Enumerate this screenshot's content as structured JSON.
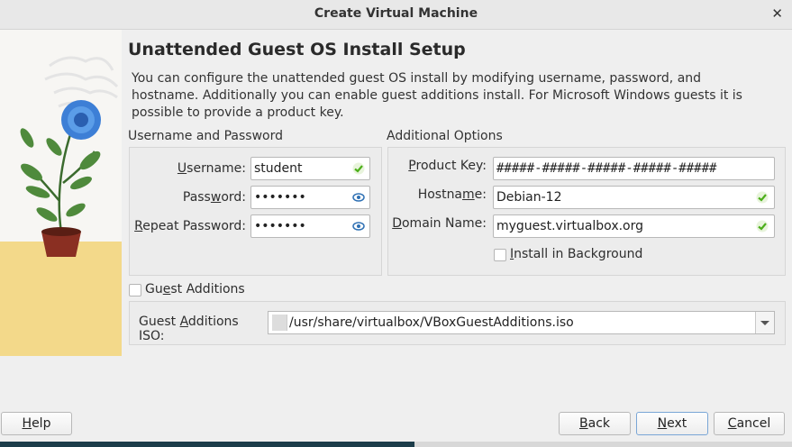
{
  "window": {
    "title": "Create Virtual Machine",
    "close_glyph": "✕"
  },
  "page": {
    "heading": "Unattended Guest OS Install Setup",
    "description": "You can configure the unattended guest OS install by modifying username, password, and hostname. Additionally you can enable guest additions install. For Microsoft Windows guests it is possible to provide a product key."
  },
  "credentials": {
    "group_title": "Username and Password",
    "username_label_pre": "",
    "username_label_u": "U",
    "username_label_post": "sername:",
    "username_value": "student",
    "password_label_pre": "Pass",
    "password_label_u": "w",
    "password_label_post": "ord:",
    "password_value": "•••••••",
    "repeat_label_pre": "",
    "repeat_label_u": "R",
    "repeat_label_post": "epeat Password:",
    "repeat_value": "•••••••"
  },
  "additional": {
    "group_title": "Additional Options",
    "product_key_label_pre": "",
    "product_key_label_u": "P",
    "product_key_label_post": "roduct Key:",
    "product_key_value": "#####-#####-#####-#####-#####",
    "hostname_label_pre": "Hostna",
    "hostname_label_u": "m",
    "hostname_label_post": "e:",
    "hostname_value": "Debian-12",
    "domain_label_pre": "",
    "domain_label_u": "D",
    "domain_label_post": "omain Name:",
    "domain_value": "myguest.virtualbox.org",
    "install_bg_pre": "",
    "install_bg_u": "I",
    "install_bg_post": "nstall in Background",
    "install_bg_checked": false
  },
  "guest_additions": {
    "checkbox_pre": "Gu",
    "checkbox_u": "e",
    "checkbox_post": "st Additions",
    "checked": false,
    "iso_label_pre": "Guest ",
    "iso_label_u": "A",
    "iso_label_post": "dditions ISO:",
    "iso_value": "/usr/share/virtualbox/VBoxGuestAdditions.iso"
  },
  "buttons": {
    "help_u": "H",
    "help_post": "elp",
    "back_u": "B",
    "back_post": "ack",
    "next_u": "N",
    "next_post": "ext",
    "cancel_u": "C",
    "cancel_post": "ancel"
  },
  "colors": {
    "ok_green": "#4caf1a",
    "eye_blue": "#2d6fb3",
    "accent": "#7aa6d6"
  },
  "icons": [
    "close-icon",
    "ok-check-icon",
    "eye-icon",
    "file-icon",
    "chevron-down-icon"
  ]
}
